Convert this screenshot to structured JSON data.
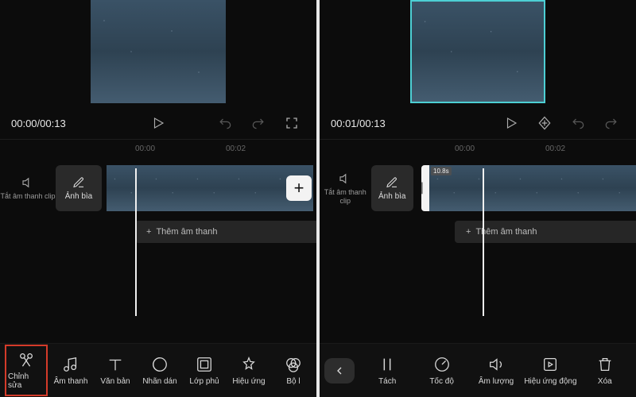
{
  "left": {
    "time": "00:00/00:13",
    "ruler": {
      "t0": "00:00",
      "t1": "00:02"
    },
    "mute": {
      "label": "Tắt âm thanh clip"
    },
    "cover": {
      "label": "Ảnh bìa"
    },
    "audio_add": "Thêm âm thanh",
    "toolbar": [
      {
        "label": "Chỉnh sửa"
      },
      {
        "label": "Âm thanh"
      },
      {
        "label": "Văn bản"
      },
      {
        "label": "Nhãn dán"
      },
      {
        "label": "Lớp phủ"
      },
      {
        "label": "Hiệu ứng"
      },
      {
        "label": "Bộ l"
      }
    ]
  },
  "right": {
    "time": "00:01/00:13",
    "ruler": {
      "t0": "00:00",
      "t1": "00:02"
    },
    "mute": {
      "label": "Tắt âm thanh clip"
    },
    "cover": {
      "label": "Ảnh bìa"
    },
    "clip_duration": "10.8s",
    "audio_add": "Thêm âm thanh",
    "toolbar": [
      {
        "label": "Tách"
      },
      {
        "label": "Tốc độ"
      },
      {
        "label": "Âm lượng"
      },
      {
        "label": "Hiệu ứng động"
      },
      {
        "label": "Xóa"
      }
    ]
  }
}
